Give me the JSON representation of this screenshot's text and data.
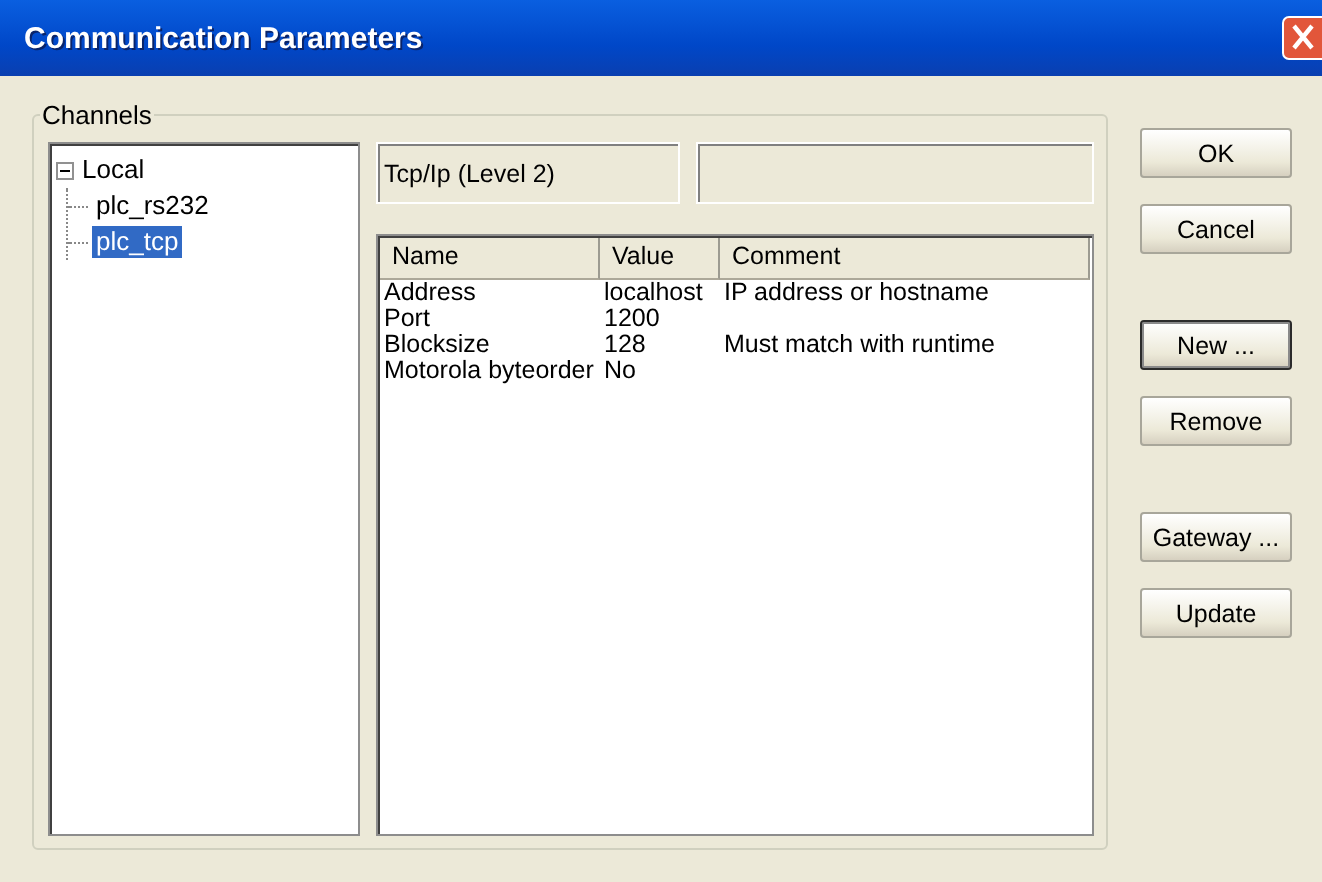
{
  "window": {
    "title": "Communication Parameters"
  },
  "channels": {
    "label": "Channels",
    "tree": [
      {
        "label": "Local",
        "expanded": true,
        "selected": false,
        "children": [
          {
            "label": "plc_rs232",
            "selected": false
          },
          {
            "label": "plc_tcp",
            "selected": true
          }
        ]
      }
    ]
  },
  "protocol": {
    "name": "Tcp/Ip (Level 2)"
  },
  "parameters": {
    "columns": [
      "Name",
      "Value",
      "Comment"
    ],
    "rows": [
      [
        "Address",
        "localhost",
        "IP address or hostname"
      ],
      [
        "Port",
        "1200",
        ""
      ],
      [
        "Blocksize",
        "128",
        "Must match with runtime"
      ],
      [
        "Motorola byteorder",
        "No",
        ""
      ]
    ]
  },
  "button_groups": [
    [
      {
        "label": "OK",
        "focused": false
      },
      {
        "label": "Cancel",
        "focused": false
      }
    ],
    [
      {
        "label": "New ...",
        "focused": true
      },
      {
        "label": "Remove",
        "focused": false
      }
    ],
    [
      {
        "label": "Gateway ...",
        "focused": false
      },
      {
        "label": "Update",
        "focused": false
      }
    ]
  ]
}
